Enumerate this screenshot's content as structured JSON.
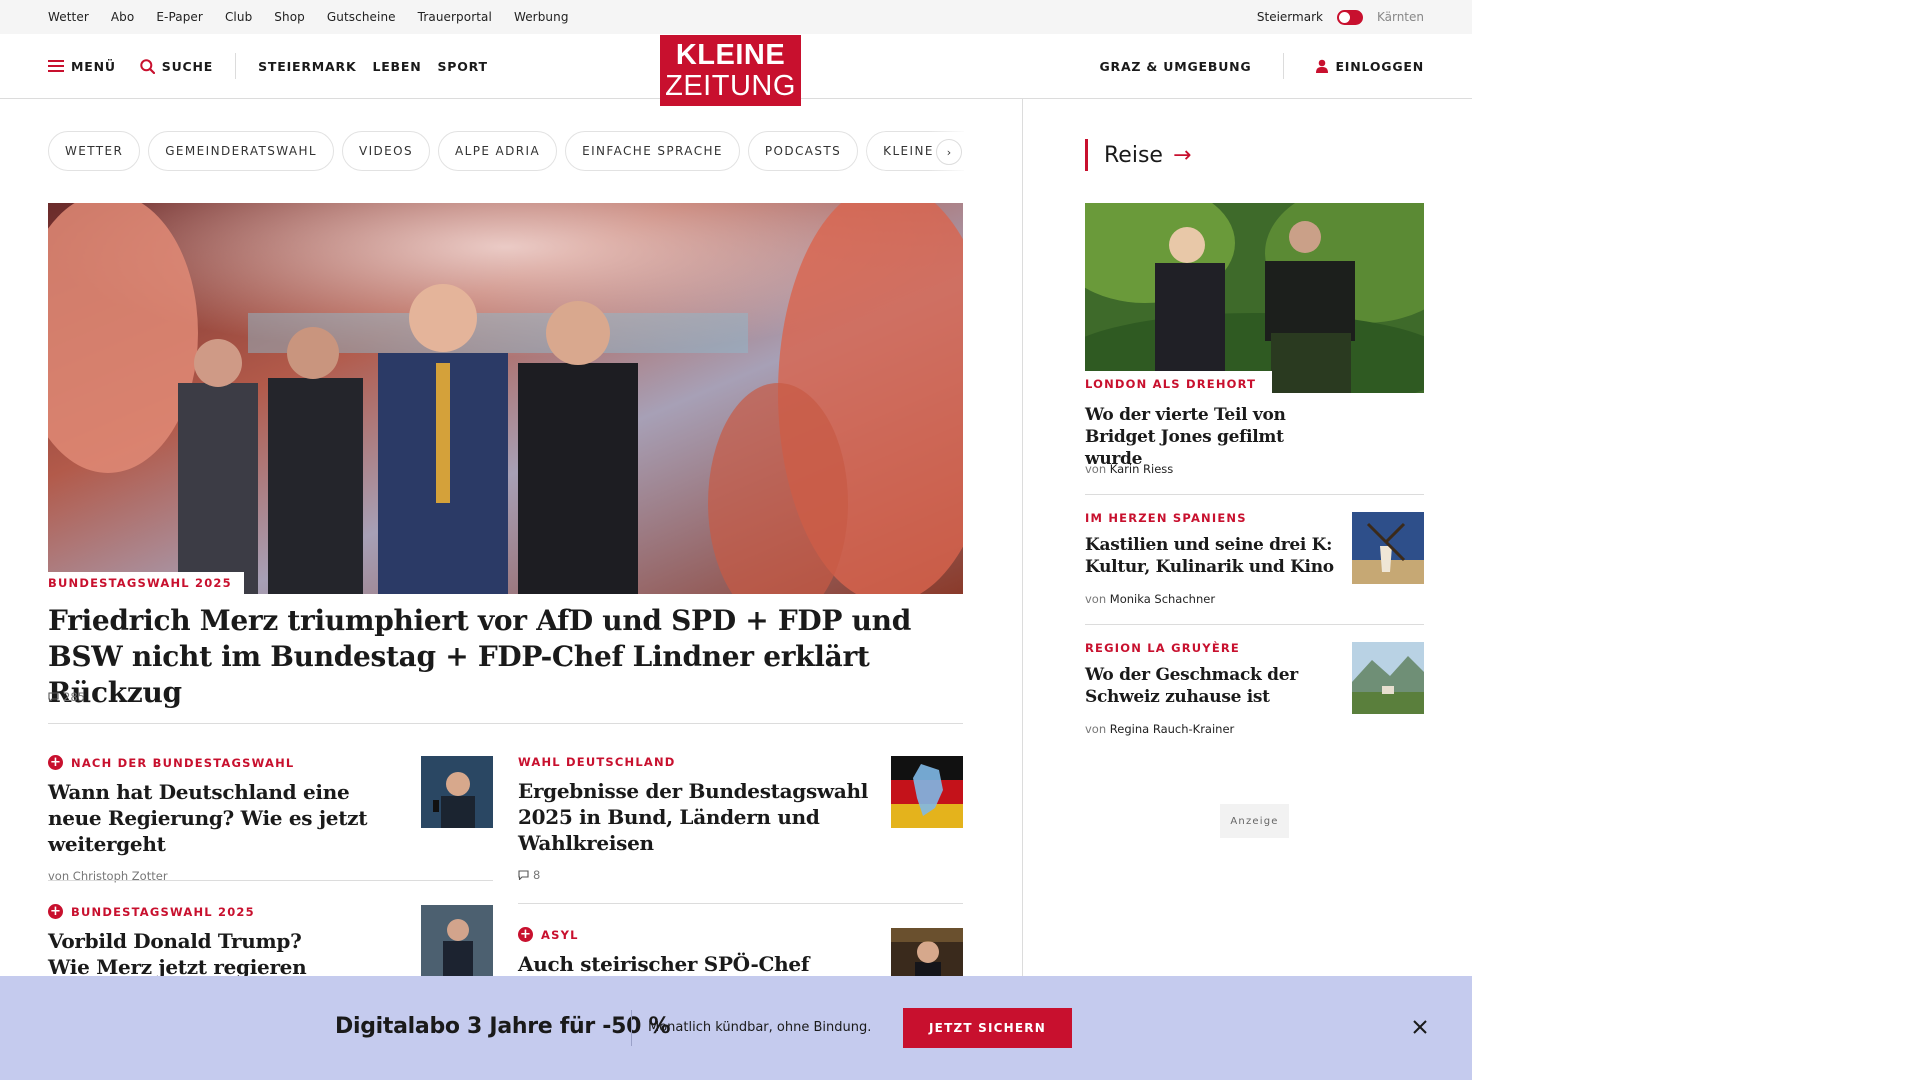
{
  "utility_bar": {
    "links": [
      "Wetter",
      "Abo",
      "E-Paper",
      "Club",
      "Shop",
      "Gutscheine",
      "Trauerportal",
      "Werbung"
    ],
    "region_left": "Steiermark",
    "region_right": "Kärnten"
  },
  "header": {
    "menu_label": "Menü",
    "search_label": "Suche",
    "nav": [
      "Steiermark",
      "Leben",
      "Sport"
    ],
    "logo_line1": "KLEINE",
    "logo_line2": "ZEITUNG",
    "region_link": "Graz & Umgebung",
    "login_label": "Einloggen"
  },
  "chips": {
    "items": [
      "Wetter",
      "Gemeinderatswahl",
      "Videos",
      "Alpe Adria",
      "Einfache Sprache",
      "Podcasts",
      "Kleine Ki"
    ],
    "next_glyph": "›"
  },
  "hero": {
    "kicker": "Bundestagswahl 2025",
    "title": "Friedrich Merz triumphiert vor AfD und SPD + FDP und BSW nicht im Bundestag + FDP-Chef Lindner erklärt Rückzug",
    "comments": "285"
  },
  "teasers": [
    {
      "kicker": "Nach der Bundestagswahl",
      "plus": true,
      "title": "Wann hat Deutschland eine neue Regierung? Wie es jetzt weitergeht",
      "byline": "von Christoph Zotter"
    },
    {
      "kicker": "Wahl Deutschland",
      "plus": false,
      "title": "Ergebnisse der Bundestagswahl 2025 in Bund, Ländern und Wahlkreisen",
      "comments": "8"
    },
    {
      "kicker": "Bundestagswahl 2025",
      "plus": true,
      "title": "Vorbild Donald Trump? Wie Merz jetzt regieren will"
    },
    {
      "kicker": "Asyl",
      "plus": true,
      "title": "Auch steirischer SPÖ-Chef"
    }
  ],
  "sidebar": {
    "section": "Reise",
    "arrow": "→",
    "lead": {
      "kicker": "London als Drehort",
      "title": "Wo der vierte Teil von Bridget Jones gefilmt wurde",
      "by_prefix": "von",
      "author": "Karin Riess"
    },
    "items": [
      {
        "kicker": "Im Herzen Spaniens",
        "title": "Kastilien und seine drei K: Kultur, Kulinarik und Kino",
        "by_prefix": "von",
        "author": "Monika Schachner"
      },
      {
        "kicker": "Region La Gruyère",
        "title": "Wo der Geschmack der Schweiz zuhause ist",
        "by_prefix": "von",
        "author": "Regina Rauch-Krainer"
      }
    ],
    "ad_label": "Anzeige"
  },
  "promo": {
    "headline": "Digitalabo 3 Jahre für -50 %",
    "subline": "Monatlich kündbar, ohne Bindung.",
    "cta": "Jetzt sichern"
  },
  "colors": {
    "brand_red": "#c8102e",
    "promo_bg": "#c5cbee",
    "utility_bg": "#f5f5f5"
  },
  "icons": [
    "hamburger-icon",
    "search-icon",
    "user-icon",
    "comment-icon",
    "plus-icon",
    "chevron-right-icon",
    "arrow-right-icon",
    "close-icon"
  ]
}
